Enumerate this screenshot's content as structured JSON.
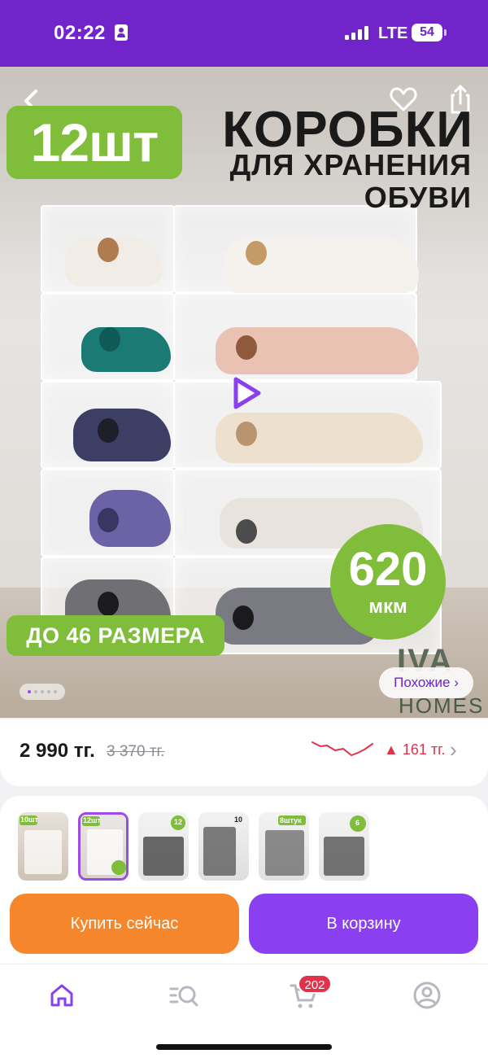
{
  "status_bar": {
    "time": "02:22",
    "network": "LTE",
    "battery": "54"
  },
  "hero": {
    "qty_badge": "12шт",
    "title_line1": "КОРОБКИ",
    "title_line2": "ДЛЯ ХРАНЕНИЯ",
    "title_line3": "ОБУВИ",
    "thickness_value": "620",
    "thickness_unit": "мкм",
    "size_badge": "ДО 46 РАЗМЕРА",
    "brand_mark": "IVA",
    "brand_text": "HOMES",
    "similar_button": "Похожие ›",
    "pager": {
      "count": 5,
      "active": 1
    }
  },
  "price": {
    "current": "2 990 тг.",
    "old": "3 370 тг.",
    "change": "▲ 161 тг.",
    "chevron": "›"
  },
  "thumbnails": [
    {
      "label": "10шт",
      "selected": false
    },
    {
      "label": "12шт",
      "selected": true
    },
    {
      "label": "12",
      "selected": false
    },
    {
      "label": "10",
      "selected": false
    },
    {
      "label": "8штук",
      "selected": false
    },
    {
      "label": "6",
      "selected": false
    }
  ],
  "actions": {
    "buy_now": "Купить сейчас",
    "add_to_cart": "В корзину"
  },
  "tab_bar": {
    "cart_count": "202",
    "active_tab": "home"
  },
  "colors": {
    "purple": "#7024c9",
    "green_badge": "#7fbd3a",
    "orange": "#f6862b",
    "price_up": "#e0334b"
  }
}
